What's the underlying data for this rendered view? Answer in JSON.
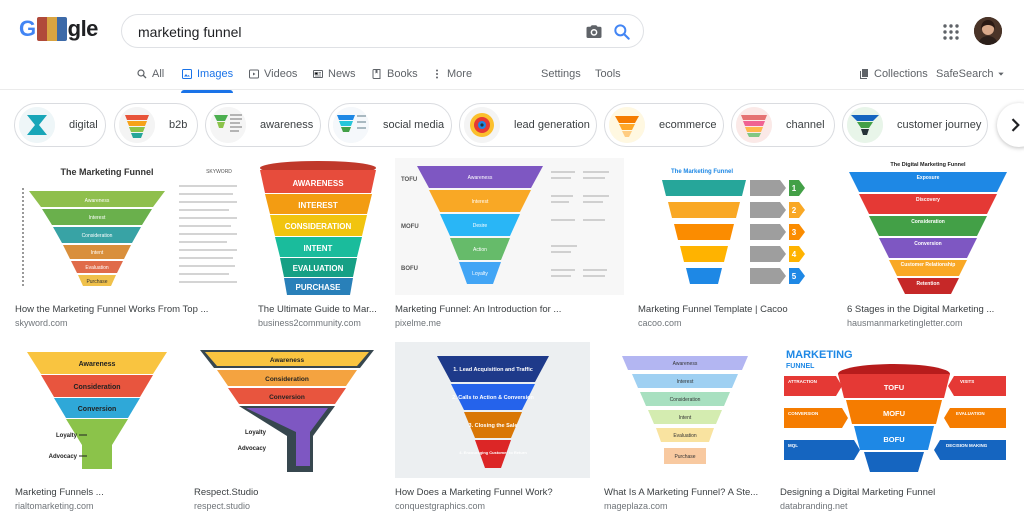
{
  "search": {
    "query": "marketing funnel"
  },
  "logo": {
    "text_left": "G",
    "text_right": "gle"
  },
  "tabs": [
    {
      "label": "All",
      "icon": "search-icon"
    },
    {
      "label": "Images",
      "icon": "image-icon",
      "active": true
    },
    {
      "label": "Videos",
      "icon": "play-icon"
    },
    {
      "label": "News",
      "icon": "news-icon"
    },
    {
      "label": "Books",
      "icon": "book-icon"
    },
    {
      "label": "More",
      "icon": "more-vert-icon"
    },
    {
      "label": "Settings"
    },
    {
      "label": "Tools"
    }
  ],
  "tools_right": {
    "collections": "Collections",
    "safesearch": "SafeSearch"
  },
  "chips": [
    "digital",
    "b2b",
    "awareness",
    "social media",
    "lead generation",
    "ecommerce",
    "channel",
    "customer journey"
  ],
  "results_row1": [
    {
      "title": "How the Marketing Funnel Works From Top ...",
      "source": "skyword.com"
    },
    {
      "title": "The Ultimate Guide to Mar...",
      "source": "business2community.com"
    },
    {
      "title": "Marketing Funnel: An Introduction for ...",
      "source": "pixelme.me"
    },
    {
      "title": "Marketing Funnel Template | Cacoo",
      "source": "cacoo.com"
    },
    {
      "title": "6 Stages in the Digital Marketing ...",
      "source": "hausmanmarketingletter.com"
    }
  ],
  "results_row2": [
    {
      "title": "Marketing Funnels ...",
      "source": "rialtomarketing.com"
    },
    {
      "title": "Respect.Studio",
      "source": "respect.studio"
    },
    {
      "title": "How Does a Marketing Funnel Work?",
      "source": "conquestgraphics.com"
    },
    {
      "title": "What Is A Marketing Funnel? A Ste...",
      "source": "mageplaza.com"
    },
    {
      "title": "Designing a Digital Marketing Funnel",
      "source": "databranding.net"
    }
  ],
  "thumbs": {
    "skyword": {
      "title": "The Marketing Funnel",
      "brand": "SKYWORD",
      "stages": [
        "Awareness",
        "Interest",
        "Consideration",
        "Intent",
        "Evaluation",
        "Purchase"
      ]
    },
    "b2c": {
      "stages": [
        "AWARENESS",
        "INTEREST",
        "CONSIDERATION",
        "INTENT",
        "EVALUATION",
        "PURCHASE"
      ]
    },
    "pixelme": {
      "sides": [
        "TOFU",
        "MOFU",
        "BOFU"
      ],
      "stages": [
        "Awareness",
        "Interest",
        "Desire",
        "Action",
        "Loyalty"
      ]
    },
    "cacoo": {
      "title": "The Marketing Funnel",
      "numbers": [
        "1",
        "2",
        "3",
        "4",
        "5"
      ]
    },
    "hausman": {
      "title": "The Digital Marketing Funnel",
      "stages": [
        "Exposure",
        "Discovery",
        "Consideration",
        "Conversion",
        "Customer Relationship",
        "Retention"
      ]
    },
    "rialto": {
      "stages": [
        "Awareness",
        "Consideration",
        "Conversion"
      ],
      "side": [
        "Loyalty",
        "Advocacy"
      ]
    },
    "respect": {
      "stages": [
        "Awareness",
        "Consideration",
        "Conversion"
      ],
      "side": [
        "Loyalty",
        "Advocacy"
      ]
    },
    "conquest": {
      "stages": [
        "1. Lead Acquisition and Traffic",
        "2. Calls to Action & Conversion",
        "3. Closing the Sale",
        "4. Encouraging Customer to Return"
      ]
    },
    "mageplaza": {
      "stages": [
        "Awareness",
        "Interest",
        "Consideration",
        "Intent",
        "Evaluation",
        "Purchase"
      ]
    },
    "databranding": {
      "title": "MARKETING",
      "subtitle": "FUNNEL",
      "levels": [
        "TOFU",
        "MOFU",
        "BOFU"
      ],
      "left": [
        "ATTRACTION",
        "CONVERSION",
        "MQL"
      ],
      "right": [
        "VISITS",
        "EVALUATION",
        "DECISION MAKING"
      ]
    }
  },
  "colors": {
    "accent": "#1a73e8"
  }
}
